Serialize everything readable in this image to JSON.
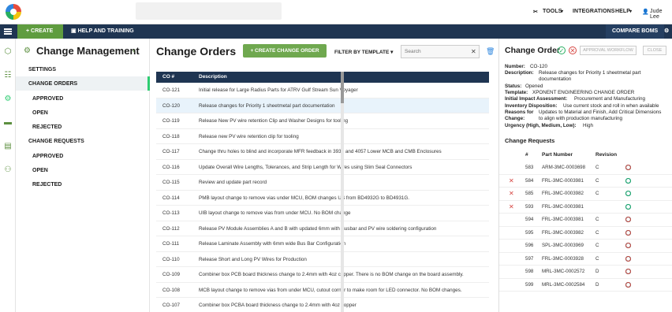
{
  "topbar": {
    "tools": "TOOLS",
    "integrations": "INTEGRATIONS",
    "help": "HELP",
    "user": "Jude Lee"
  },
  "navbar": {
    "create": "CREATE",
    "help_training": "HELP AND TRAINING",
    "compare_boms": "COMPARE BOMS"
  },
  "sidebar": {
    "title": "Change Management",
    "items": [
      {
        "label": "SETTINGS"
      },
      {
        "label": "CHANGE ORDERS"
      },
      {
        "label": "APPROVED"
      },
      {
        "label": "OPEN"
      },
      {
        "label": "REJECTED"
      },
      {
        "label": "CHANGE REQUESTS"
      },
      {
        "label": "APPROVED"
      },
      {
        "label": "OPEN"
      },
      {
        "label": "REJECTED"
      }
    ]
  },
  "main": {
    "title": "Change Orders",
    "create_button": "CREATE CHANGE ORDER",
    "filter": "FILTER BY TEMPLATE",
    "search_placeholder": "Search",
    "columns": [
      "CO #",
      "Description"
    ],
    "rows": [
      {
        "co": "CO-121",
        "desc": "Initial release for Large Radius Parts for ATRV Gulf Stream Sun Voyager"
      },
      {
        "co": "CO-120",
        "desc": "Release changes for Priority 1 sheetmetal part documentation"
      },
      {
        "co": "CO-119",
        "desc": "Release New PV wire retention Clip and Washer Designs for tooling"
      },
      {
        "co": "CO-118",
        "desc": "Release  new PV wire retention clip for tooling"
      },
      {
        "co": "CO-117",
        "desc": "Change thru holes to blind and incorporate MFR feedback  in 3937 and 4057 Lower MCB and CMB Enclosures"
      },
      {
        "co": "CO-116",
        "desc": "Update Overall Wire Lengths, Tolerances, and Strip Length for Wires using Slim Seal Connectors"
      },
      {
        "co": "CO-115",
        "desc": "Review and update part record"
      },
      {
        "co": "CO-114",
        "desc": "PMB layout change to remove vias under MCU, BOM changes US from BD4932G to BD4931G."
      },
      {
        "co": "CO-113",
        "desc": "UIB layout change to remove vias from under MCU. No BOM change"
      },
      {
        "co": "CO-112",
        "desc": "Release PV Module Assemblies A and B with updated 6mm with Busbar and PV wire soldering configuration"
      },
      {
        "co": "CO-111",
        "desc": "Release Laminate Assembly with 6mm wide Bus Bar Configuration"
      },
      {
        "co": "CO-110",
        "desc": "Release Short and Long PV Wires for Production"
      },
      {
        "co": "CO-109",
        "desc": "Combiner box PCB board thickness change to 2.4mm with 4oz copper.  There is no BOM change on the board assembly."
      },
      {
        "co": "CO-108",
        "desc": "MCB layout change to remove vias from under MCU, cutout corner to make room for LED connector.  No BOM changes."
      },
      {
        "co": "CO-107",
        "desc": "Combiner box PCBA board thickness change to 2.4mm with 4oz copper"
      }
    ]
  },
  "detail": {
    "title": "Change Order",
    "approval_btn": "APPROVAL WORKFLOW",
    "close_btn": "CLOSE",
    "fields": {
      "number_label": "Number:",
      "number": "CO-120",
      "desc_label": "Description:",
      "desc1": "Release changes for Priority 1 sheetmetal part",
      "desc2": "documentation",
      "status_label": "Status:",
      "status": "Opened",
      "template_label": "Template:",
      "template": "XPONENT ENGINEERING CHANGE ORDER",
      "impact_label": "Initial Impact Assessment:",
      "impact": "Procurement and Manufacturing",
      "inventory_label": "Inventory Disposition:",
      "inventory": "Use current stock and roll in when available",
      "reasons_label1": "Reasons for",
      "reasons_label2": "Change:",
      "reasons1": "Updates to Material and Finish, Add Critical Dimensions",
      "reasons2": "to align with production manufacturing",
      "urgency_label": "Urgency (High, Medium, Low):",
      "urgency": "High"
    },
    "cr_title": "Change Requests",
    "cr_columns": [
      "#",
      "Part Number",
      "Revision"
    ],
    "cr_rows": [
      {
        "num": "583",
        "part": "ARM-3MC-0003698",
        "rev": "C",
        "x": false
      },
      {
        "num": "584",
        "part": "FRL-3MC-0003981",
        "rev": "C",
        "x": true
      },
      {
        "num": "585",
        "part": "FRL-3MC-0003982",
        "rev": "C",
        "x": true
      },
      {
        "num": "593",
        "part": "FRL-3MC-0003981",
        "rev": "",
        "x": true
      },
      {
        "num": "594",
        "part": "FRL-3MC-0003981",
        "rev": "C",
        "x": false
      },
      {
        "num": "595",
        "part": "FRL-3MC-0003982",
        "rev": "C",
        "x": false
      },
      {
        "num": "596",
        "part": "SPL-3MC-0003969",
        "rev": "C",
        "x": false
      },
      {
        "num": "597",
        "part": "FRL-3MC-0003928",
        "rev": "C",
        "x": false
      },
      {
        "num": "598",
        "part": "MRL-3MC-0002572",
        "rev": "D",
        "x": false
      },
      {
        "num": "599",
        "part": "MRL-3MC-0002584",
        "rev": "D",
        "x": false
      }
    ]
  }
}
